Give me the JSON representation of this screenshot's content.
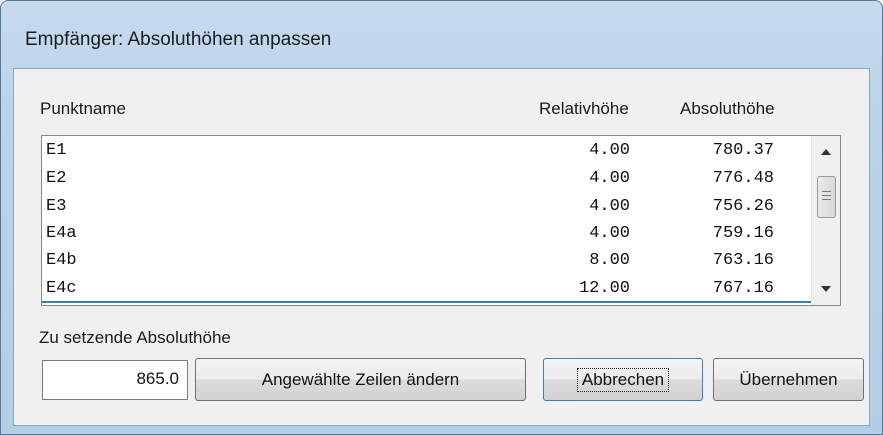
{
  "window": {
    "title": "Empfänger: Absoluthöhen anpassen"
  },
  "headers": {
    "name": "Punktname",
    "rel": "Relativhöhe",
    "abs": "Absoluthöhe"
  },
  "rows": [
    {
      "name": "E1",
      "rel": "4.00",
      "abs": "780.37"
    },
    {
      "name": "E2",
      "rel": "4.00",
      "abs": "776.48"
    },
    {
      "name": "E3",
      "rel": "4.00",
      "abs": "756.26"
    },
    {
      "name": "E4a",
      "rel": "4.00",
      "abs": "759.16"
    },
    {
      "name": "E4b",
      "rel": "8.00",
      "abs": "763.16"
    },
    {
      "name": "E4c",
      "rel": "12.00",
      "abs": "767.16"
    }
  ],
  "scrollbar": {
    "up_icon": "chevron-up-icon",
    "down_icon": "chevron-down-icon"
  },
  "form": {
    "label": "Zu setzende Absoluthöhe",
    "value": "865.0"
  },
  "buttons": {
    "apply_selected": "Angewählte Zeilen ändern",
    "cancel": "Abbrechen",
    "accept": "Übernehmen"
  },
  "colors": {
    "selection_underline": "#3c7fb1",
    "titlebar": "#bdd4ea"
  }
}
